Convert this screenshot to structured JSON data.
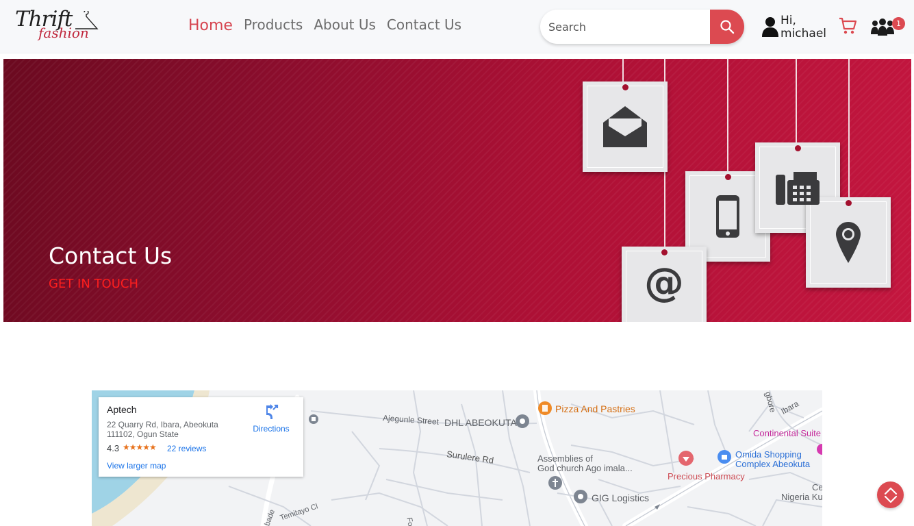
{
  "header": {
    "logo": {
      "line1": "Thrift",
      "line2": "fashion"
    },
    "nav": [
      {
        "label": "Home",
        "active": true
      },
      {
        "label": "Products",
        "active": false
      },
      {
        "label": "About Us",
        "active": false
      },
      {
        "label": "Contact Us",
        "active": false
      }
    ],
    "search": {
      "placeholder": "Search",
      "value": ""
    },
    "user": {
      "greeting": "Hi,",
      "name": "michael"
    },
    "friends_badge": "1",
    "accent_color": "#dc4a51"
  },
  "banner": {
    "title": "Contact Us",
    "subtitle": "GET IN TOUCH",
    "background_color": "#8c0d2d",
    "tag_icons": [
      "envelope-icon",
      "mobile-phone-icon",
      "fax-phone-icon",
      "location-pin-icon",
      "at-sign-icon"
    ]
  },
  "map": {
    "place_card": {
      "name": "Aptech",
      "address": "22 Quarry Rd, Ibara, Abeokuta 111102, Ogun State",
      "rating": "4.3",
      "stars": "★★★★★",
      "reviews": "22 reviews",
      "directions": "Directions",
      "view_larger": "View larger map"
    },
    "labels": {
      "ajegunle": "Ajegunle Street",
      "dhl": "DHL ABEOKUTA",
      "pizza": "Pizza And Pastries",
      "continental": "Continental Suite",
      "surulere": "Surulere Rd",
      "assemblies1": "Assemblies of",
      "assemblies2": "God church Ago imala...",
      "omida1": "Omida Shopping",
      "omida2": "Complex Abeokuta",
      "pharmacy": "Precious Pharmacy",
      "gig": "GIG Logistics",
      "nigeria": "Nigeria Ku",
      "ce": "Ce",
      "ibara": "Ibara",
      "igbore": "gbore",
      "temitayo": "Temitayo Cl",
      "bade": "bade",
      "fo": "Fo"
    }
  }
}
